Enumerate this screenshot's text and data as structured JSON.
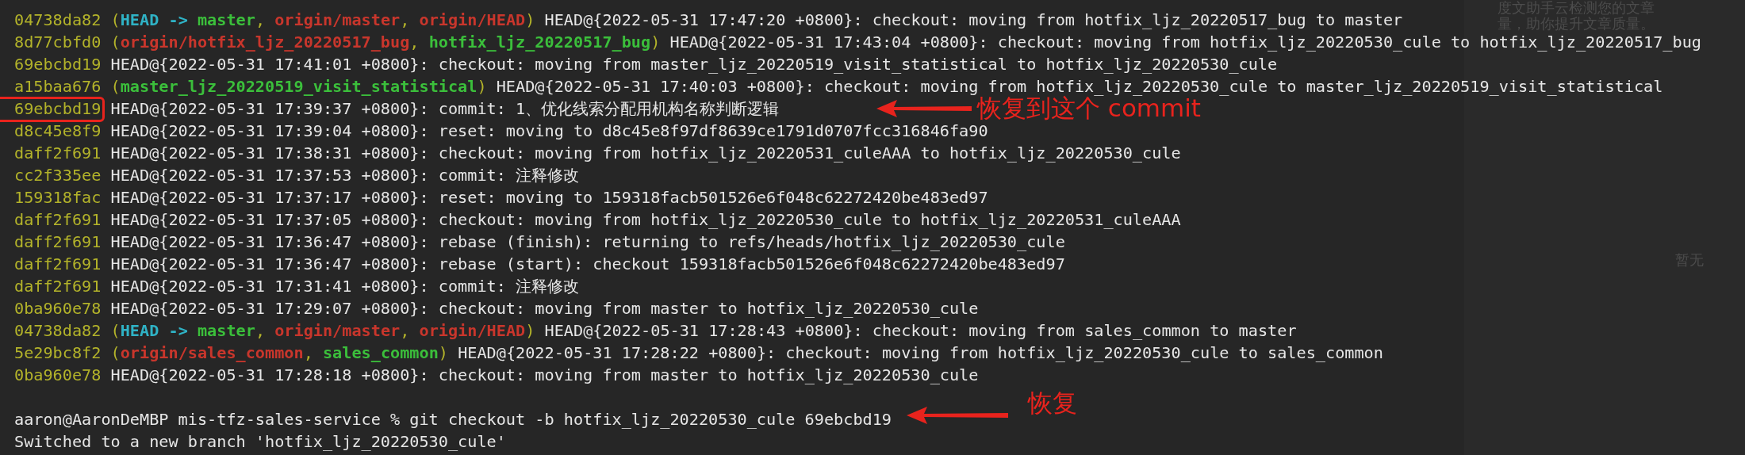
{
  "lines": [
    {
      "hash": "04738da82",
      "refs_open": "(",
      "refs_close": ")",
      "refs": [
        {
          "head": "HEAD ->",
          "name": "master",
          "kind": "local",
          "sep": ","
        },
        {
          "name": "origin/master",
          "kind": "remote",
          "sep": ","
        },
        {
          "name": "origin/HEAD",
          "kind": "remote"
        }
      ],
      "text": "HEAD@{2022-05-31 17:47:20 +0800}: checkout: moving from hotfix_ljz_20220517_bug to master",
      "highlighted": false
    },
    {
      "hash": "8d77cbfd0",
      "refs_open": "(",
      "refs_close": ")",
      "refs": [
        {
          "name": "origin/hotfix_ljz_20220517_bug",
          "kind": "remote",
          "sep": ","
        },
        {
          "name": "hotfix_ljz_20220517_bug",
          "kind": "local"
        }
      ],
      "text": "HEAD@{2022-05-31 17:43:04 +0800}: checkout: moving from hotfix_ljz_20220530_cule to hotfix_ljz_20220517_bug",
      "highlighted": false
    },
    {
      "hash": "69ebcbd19",
      "text": "HEAD@{2022-05-31 17:41:01 +0800}: checkout: moving from master_ljz_20220519_visit_statistical to hotfix_ljz_20220530_cule",
      "highlighted": false
    },
    {
      "hash": "a15baa676",
      "refs_open": "(",
      "refs_close": ")",
      "refs": [
        {
          "name": "master_ljz_20220519_visit_statistical",
          "kind": "local"
        }
      ],
      "text": "HEAD@{2022-05-31 17:40:03 +0800}: checkout: moving from hotfix_ljz_20220530_cule to master_ljz_20220519_visit_statistical",
      "highlighted": false
    },
    {
      "hash": "69ebcbd19",
      "text": "HEAD@{2022-05-31 17:39:37 +0800}: commit: 1、优化线索分配用机构名称判断逻辑",
      "highlighted": true
    },
    {
      "hash": "d8c45e8f9",
      "text": "HEAD@{2022-05-31 17:39:04 +0800}: reset: moving to d8c45e8f97df8639ce1791d0707fcc316846fa90",
      "highlighted": false
    },
    {
      "hash": "daff2f691",
      "text": "HEAD@{2022-05-31 17:38:31 +0800}: checkout: moving from hotfix_ljz_20220531_culeAAA to hotfix_ljz_20220530_cule",
      "highlighted": false
    },
    {
      "hash": "cc2f335ee",
      "text": "HEAD@{2022-05-31 17:37:53 +0800}: commit: 注释修改",
      "highlighted": false
    },
    {
      "hash": "159318fac",
      "text": "HEAD@{2022-05-31 17:37:17 +0800}: reset: moving to 159318facb501526e6f048c62272420be483ed97",
      "highlighted": false
    },
    {
      "hash": "daff2f691",
      "text": "HEAD@{2022-05-31 17:37:05 +0800}: checkout: moving from hotfix_ljz_20220530_cule to hotfix_ljz_20220531_culeAAA",
      "highlighted": false
    },
    {
      "hash": "daff2f691",
      "text": "HEAD@{2022-05-31 17:36:47 +0800}: rebase (finish): returning to refs/heads/hotfix_ljz_20220530_cule",
      "highlighted": false
    },
    {
      "hash": "daff2f691",
      "text": "HEAD@{2022-05-31 17:36:47 +0800}: rebase (start): checkout 159318facb501526e6f048c62272420be483ed97",
      "highlighted": false
    },
    {
      "hash": "daff2f691",
      "text": "HEAD@{2022-05-31 17:31:41 +0800}: commit: 注释修改",
      "highlighted": false
    },
    {
      "hash": "0ba960e78",
      "text": "HEAD@{2022-05-31 17:29:07 +0800}: checkout: moving from master to hotfix_ljz_20220530_cule",
      "highlighted": false
    },
    {
      "hash": "04738da82",
      "refs_open": "(",
      "refs_close": ")",
      "refs": [
        {
          "head": "HEAD ->",
          "name": "master",
          "kind": "local",
          "sep": ","
        },
        {
          "name": "origin/master",
          "kind": "remote",
          "sep": ","
        },
        {
          "name": "origin/HEAD",
          "kind": "remote"
        }
      ],
      "text": "HEAD@{2022-05-31 17:28:43 +0800}: checkout: moving from sales_common to master",
      "highlighted": false
    },
    {
      "hash": "5e29bc8f2",
      "refs_open": "(",
      "refs_close": ")",
      "refs": [
        {
          "name": "origin/sales_common",
          "kind": "remote",
          "sep": ","
        },
        {
          "name": "sales_common",
          "kind": "local"
        }
      ],
      "text": "HEAD@{2022-05-31 17:28:22 +0800}: checkout: moving from hotfix_ljz_20220530_cule to sales_common",
      "highlighted": false
    },
    {
      "hash": "0ba960e78",
      "text": "HEAD@{2022-05-31 17:28:18 +0800}: checkout: moving from master to hotfix_ljz_20220530_cule",
      "highlighted": false
    }
  ],
  "command": "aaron@AaronDeMBP mis-tfz-sales-service % git checkout -b hotfix_ljz_20220530_cule 69ebcbd19",
  "output": "Switched to a new branch 'hotfix_ljz_20220530_cule'",
  "annotations": [
    {
      "text": "恢复到这个 commit"
    },
    {
      "text": "恢复"
    }
  ],
  "side_panel": {
    "lines": [
      "度文助手云检测您的文章",
      "量，助你提升文章质量。"
    ],
    "empty_text": "暂无"
  }
}
